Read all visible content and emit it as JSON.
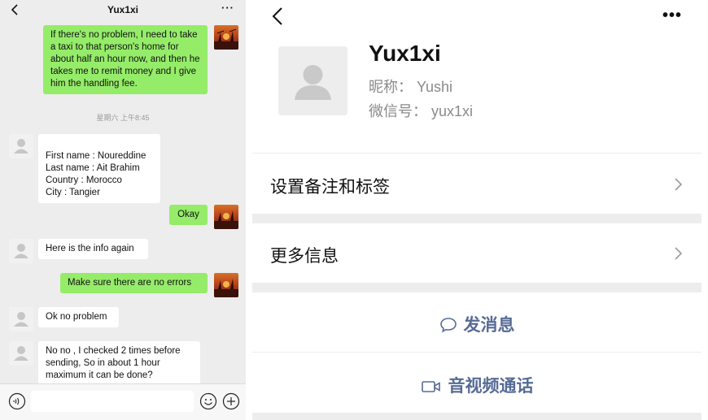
{
  "chat": {
    "title": "Yux1xi",
    "more_label": "···",
    "time_separator": "星期六 上午8:45",
    "messages": [
      {
        "sender": "me",
        "text": "If there's no problem, I need to take a taxi to that person's home for about half an hour now, and then he takes me to remit money and I give him the handling fee."
      },
      {
        "sender": "them",
        "text": "First name : Noureddine\nLast name : Ait Brahim\nCountry : Morocco\nCity : Tangier"
      },
      {
        "sender": "me",
        "text": "Okay"
      },
      {
        "sender": "them",
        "text": "Here is the info again"
      },
      {
        "sender": "me",
        "text": "Make sure there are no errors"
      },
      {
        "sender": "them",
        "text": "Ok no problem"
      },
      {
        "sender": "them",
        "text": "No no , I checked 2 times before sending, So in about 1 hour maximum it can be done?"
      }
    ],
    "input": {
      "value": "",
      "placeholder": ""
    }
  },
  "profile": {
    "name": "Yux1xi",
    "nickname_label": "昵称：",
    "nickname": "Yushi",
    "wechat_id_label": "微信号：",
    "wechat_id": "yux1xi",
    "more_label": "•••",
    "rows": {
      "remark": "设置备注和标签",
      "more_info": "更多信息"
    },
    "actions": {
      "message": "发消息",
      "call": "音视频通话"
    }
  },
  "colors": {
    "chat_background": "#ededed",
    "my_bubble": "#95ec69",
    "their_bubble": "#ffffff",
    "action_link": "#576b95"
  },
  "icons": [
    "back-chevron-icon",
    "more-dots-icon",
    "voice-icon",
    "emoji-icon",
    "plus-icon",
    "chat-bubble-icon",
    "video-camera-icon",
    "chevron-right-icon",
    "default-avatar-icon"
  ]
}
